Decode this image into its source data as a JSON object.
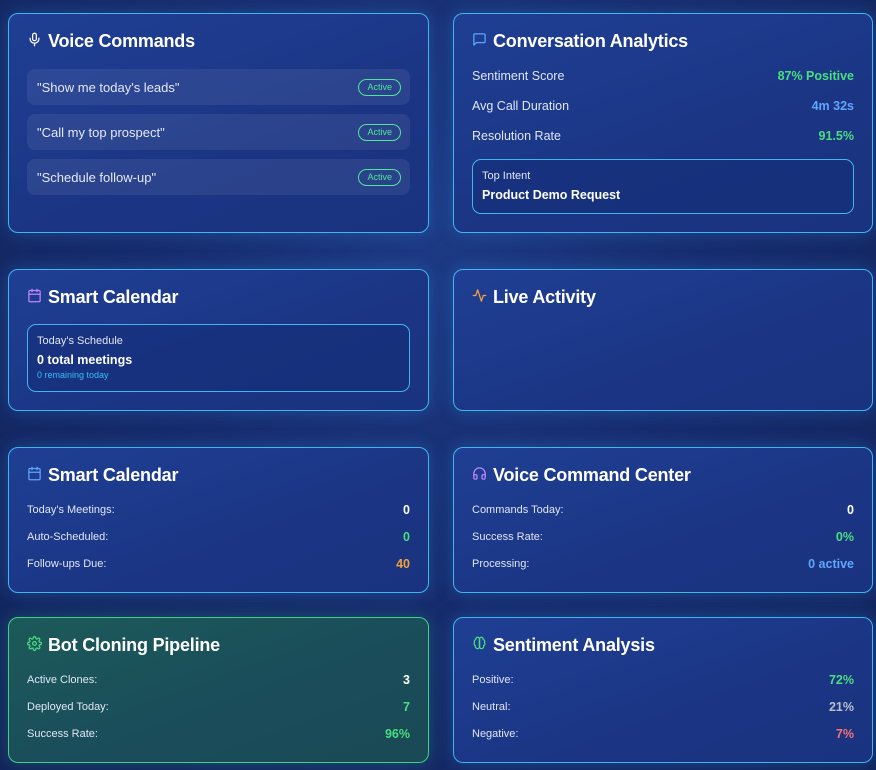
{
  "voice_commands": {
    "title": "Voice Commands",
    "items": [
      {
        "text": "\"Show me today's leads\"",
        "status": "Active"
      },
      {
        "text": "\"Call my top prospect\"",
        "status": "Active"
      },
      {
        "text": "\"Schedule follow-up\"",
        "status": "Active"
      }
    ]
  },
  "conversation_analytics": {
    "title": "Conversation Analytics",
    "rows": [
      {
        "label": "Sentiment Score",
        "value": "87% Positive"
      },
      {
        "label": "Avg Call Duration",
        "value": "4m 32s"
      },
      {
        "label": "Resolution Rate",
        "value": "91.5%"
      }
    ],
    "top_intent_label": "Top Intent",
    "top_intent_value": "Product Demo Request"
  },
  "smart_calendar_1": {
    "title": "Smart Calendar",
    "schedule_label": "Today's Schedule",
    "meetings": "0 total meetings",
    "remaining": "0 remaining today"
  },
  "live_activity": {
    "title": "Live Activity"
  },
  "smart_calendar_2": {
    "title": "Smart Calendar",
    "rows": [
      {
        "label": "Today's Meetings:",
        "value": "0"
      },
      {
        "label": "Auto-Scheduled:",
        "value": "0"
      },
      {
        "label": "Follow-ups Due:",
        "value": "40"
      }
    ]
  },
  "voice_command_center": {
    "title": "Voice Command Center",
    "rows": [
      {
        "label": "Commands Today:",
        "value": "0"
      },
      {
        "label": "Success Rate:",
        "value": "0%"
      },
      {
        "label": "Processing:",
        "value": "0 active"
      }
    ]
  },
  "bot_cloning": {
    "title": "Bot Cloning Pipeline",
    "rows": [
      {
        "label": "Active Clones:",
        "value": "3"
      },
      {
        "label": "Deployed Today:",
        "value": "7"
      },
      {
        "label": "Success Rate:",
        "value": "96%"
      }
    ]
  },
  "sentiment_analysis": {
    "title": "Sentiment Analysis",
    "rows": [
      {
        "label": "Positive:",
        "value": "72%"
      },
      {
        "label": "Neutral:",
        "value": "21%"
      },
      {
        "label": "Negative:",
        "value": "7%"
      }
    ]
  },
  "colors": {
    "accent_border": "#3fb6ee",
    "positive": "#4ade80",
    "info": "#60a5fa",
    "warning": "#f5a03a",
    "negative": "#f87171",
    "neutral": "#b8c0d0"
  },
  "icons": {
    "voice_commands": "microphone-icon",
    "conversation_analytics": "message-square-icon",
    "smart_calendar_1": "calendar-icon",
    "live_activity": "activity-icon",
    "smart_calendar_2": "calendar-icon",
    "voice_command_center": "headphones-icon",
    "bot_cloning": "gear-icon",
    "sentiment_analysis": "brain-icon"
  }
}
